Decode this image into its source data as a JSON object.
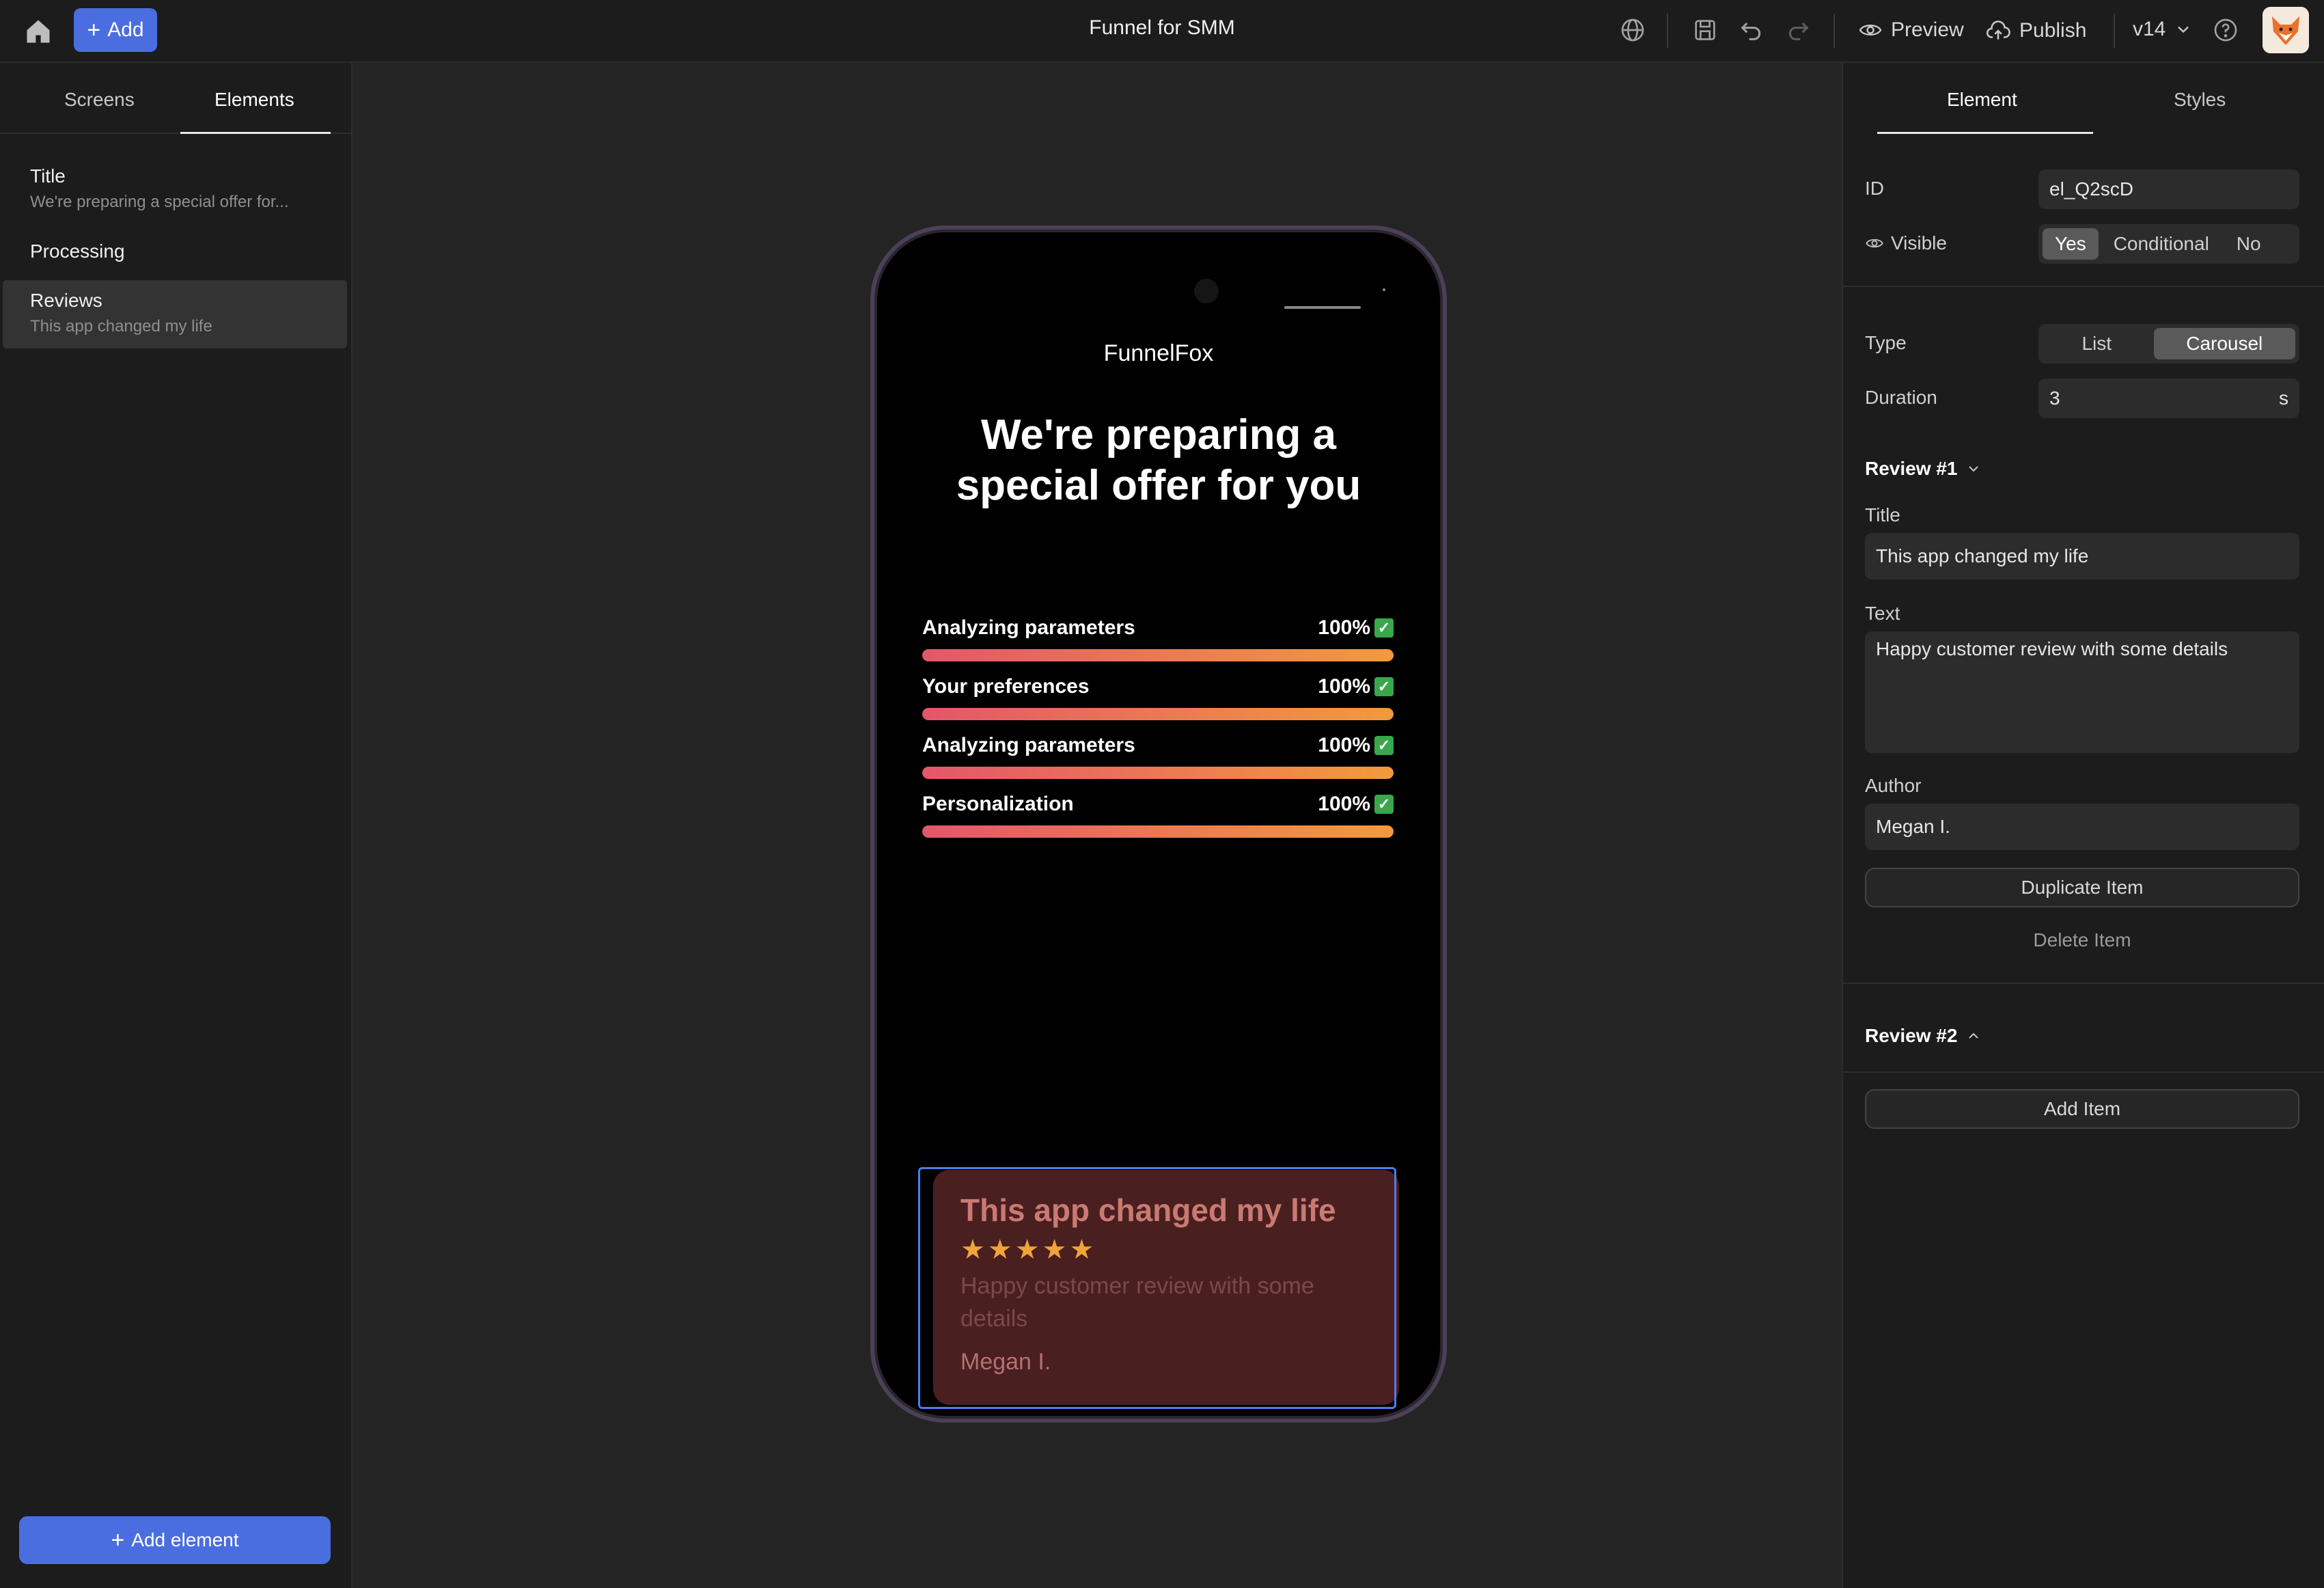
{
  "topbar": {
    "add_label": "Add",
    "doc_title": "Funnel for SMM",
    "preview_label": "Preview",
    "publish_label": "Publish",
    "version_label": "v14"
  },
  "left_panel": {
    "tabs": [
      {
        "label": "Screens",
        "active": false
      },
      {
        "label": "Elements",
        "active": true
      }
    ],
    "items": [
      {
        "name": "Title",
        "subtitle": "We're preparing a special offer for..."
      },
      {
        "name": "Processing",
        "subtitle": ""
      },
      {
        "name": "Reviews",
        "subtitle": "This app changed my life",
        "selected": true
      }
    ],
    "add_element_label": "Add element"
  },
  "phone": {
    "brand": "FunnelFox",
    "headline": "We're preparing a special offer for you",
    "progress": [
      {
        "label": "Analyzing parameters",
        "percent_text": "100%",
        "fraction": 1.0
      },
      {
        "label": "Your preferences",
        "percent_text": "100%",
        "fraction": 1.0
      },
      {
        "label": "Analyzing parameters",
        "percent_text": "100%",
        "fraction": 1.0
      },
      {
        "label": "Personalization",
        "percent_text": "100%",
        "fraction": 1.0
      }
    ],
    "review": {
      "title": "This app changed my life",
      "stars": "★★★★★",
      "rating": 5,
      "text": "Happy customer review with some details",
      "author": "Megan I."
    }
  },
  "right_panel": {
    "tabs": [
      {
        "label": "Element",
        "active": true
      },
      {
        "label": "Styles",
        "active": false
      }
    ],
    "id_label": "ID",
    "id_value": "el_Q2scD",
    "visible_label": "Visible",
    "visible_options": [
      "Yes",
      "Conditional",
      "No"
    ],
    "visible_selected": "Yes",
    "type_label": "Type",
    "type_options": [
      "List",
      "Carousel"
    ],
    "type_selected": "Carousel",
    "duration_label": "Duration",
    "duration_value": "3",
    "duration_unit": "s",
    "review1_header": "Review #1",
    "title_label": "Title",
    "title_value": "This app changed my life",
    "text_label": "Text",
    "text_value": "Happy customer review with some details",
    "author_label": "Author",
    "author_value": "Megan I.",
    "duplicate_label": "Duplicate Item",
    "delete_label": "Delete Item",
    "review2_header": "Review #2",
    "add_item_label": "Add Item"
  },
  "colors": {
    "accent": "#4a6ee0",
    "selection": "#4c7cf0",
    "bar_start": "#e4566a",
    "bar_end": "#f39a3c",
    "star": "#f0a33a",
    "review_bg": "#4a1f20"
  }
}
